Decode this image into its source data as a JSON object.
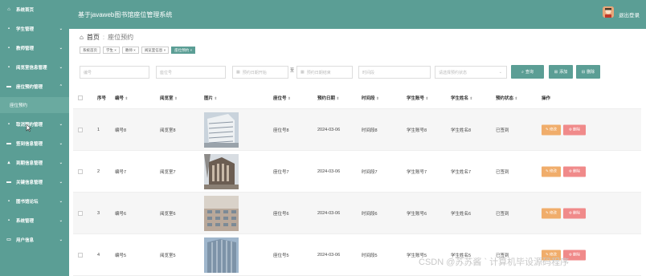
{
  "sidebar": {
    "items": [
      {
        "label": "系统首页",
        "icon": "home-icon"
      },
      {
        "label": "学生管理",
        "icon": "grid-icon"
      },
      {
        "label": "教师管理",
        "icon": "grid-icon"
      },
      {
        "label": "阅览室信息管理",
        "icon": "grid-icon"
      },
      {
        "label": "座位预约管理",
        "icon": "chair-icon"
      },
      {
        "label": "取消预约管理",
        "icon": "grid-icon"
      },
      {
        "label": "签到信息管理",
        "icon": "comment-icon"
      },
      {
        "label": "到期信息管理",
        "icon": "chart-icon"
      },
      {
        "label": "关键信息管理",
        "icon": "comment-icon"
      },
      {
        "label": "图书馆论坛",
        "icon": "grid-icon"
      },
      {
        "label": "系统管理",
        "icon": "grid-icon"
      },
      {
        "label": "用户信息",
        "icon": "user-icon"
      }
    ],
    "sub_item": "座位预约"
  },
  "header": {
    "title": "基于javaweb图书馆座位管理系统",
    "logout": "退出登录"
  },
  "breadcrumb": {
    "home": "首页",
    "current": "座位预约"
  },
  "tags": [
    "系统首页",
    "学生",
    "教师",
    "阅览室信息",
    "座位预约"
  ],
  "search": {
    "placeholders": [
      "编号",
      "座位号",
      "预约日期开始",
      "预约日期结束",
      "时间段",
      "请选择预约状态"
    ],
    "date_separator": "至",
    "query_label": "查询",
    "add_label": "添加",
    "delete_label": "删除"
  },
  "table": {
    "headers": [
      "序号",
      "编号",
      "阅览室",
      "图片",
      "座位号",
      "预约日期",
      "时间段",
      "学生账号",
      "学生姓名",
      "预约状态",
      "操作"
    ],
    "edit_label": "修改",
    "delete_label": "删除",
    "rows": [
      {
        "index": "1",
        "code": "编号8",
        "room": "阅览室8",
        "seat": "座位号8",
        "date": "2024-03-06",
        "slot": "时间段8",
        "account": "学生账号8",
        "name": "学生姓名8",
        "status": "已签到"
      },
      {
        "index": "2",
        "code": "编号7",
        "room": "阅览室7",
        "seat": "座位号7",
        "date": "2024-03-06",
        "slot": "时间段7",
        "account": "学生账号7",
        "name": "学生姓名7",
        "status": "已签到"
      },
      {
        "index": "3",
        "code": "编号6",
        "room": "阅览室6",
        "seat": "座位号6",
        "date": "2024-03-06",
        "slot": "时间段6",
        "account": "学生账号6",
        "name": "学生姓名6",
        "status": "已签到"
      },
      {
        "index": "4",
        "code": "编号5",
        "room": "阅览室5",
        "seat": "座位号5",
        "date": "2024-03-06",
        "slot": "时间段5",
        "account": "学生账号5",
        "name": "学生姓名5",
        "status": "已签到"
      }
    ]
  },
  "watermark": "CSDN @苏苏酱 ` 计算机毕设源码程序",
  "colors": {
    "primary": "#5b9e95",
    "edit": "#f0ad6b",
    "delete": "#f08a8a"
  }
}
